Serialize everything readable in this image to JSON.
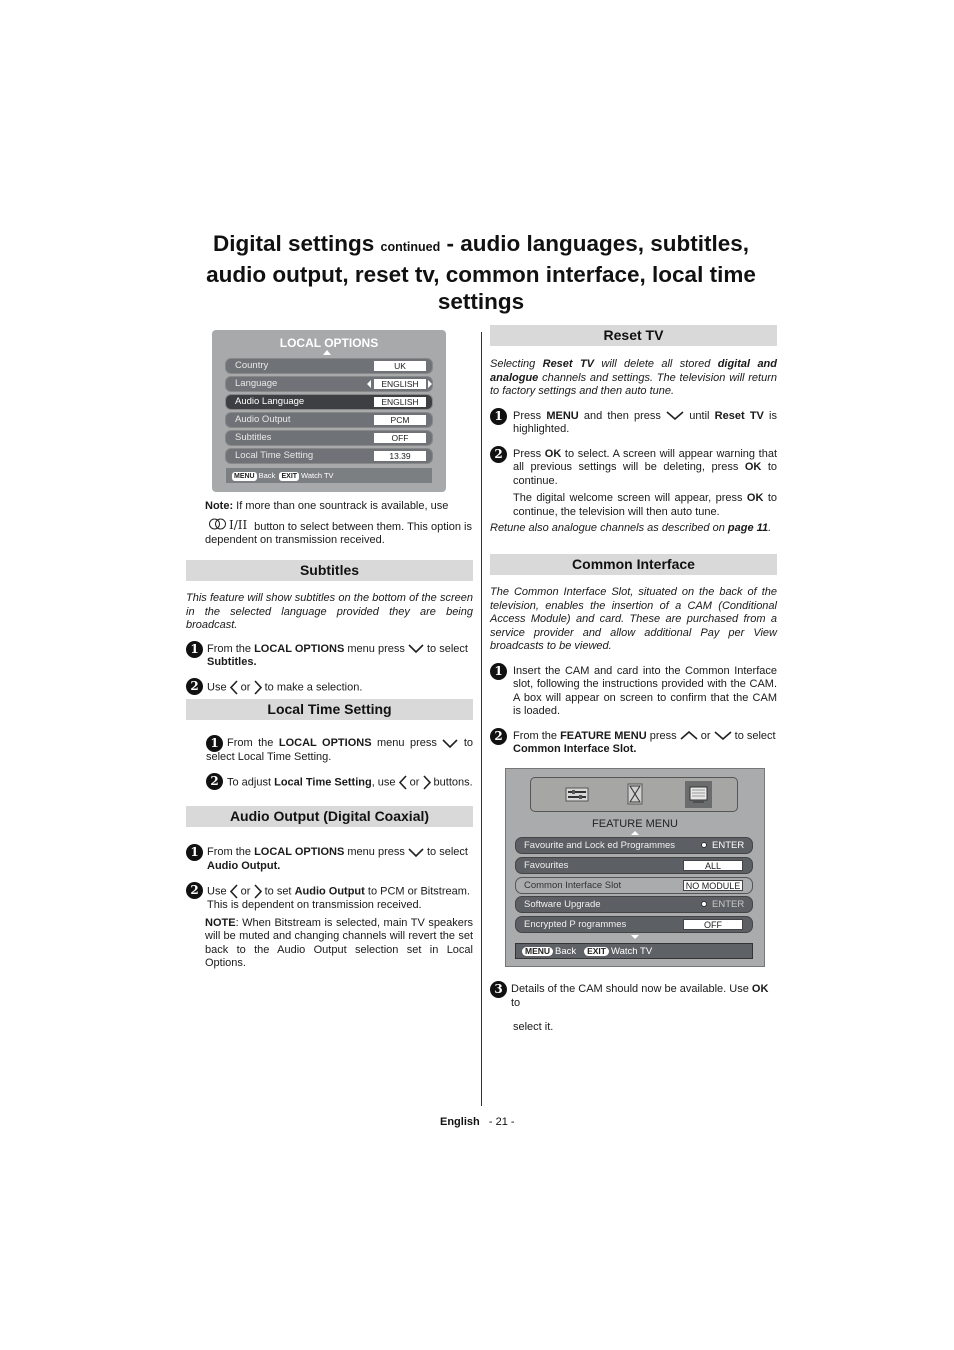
{
  "title": {
    "main": "Digital settings",
    "continued": "continued",
    "rest_line1": "- audio languages, subtitles,",
    "line2": "audio output, reset tv, common interface, local time",
    "line3": "settings"
  },
  "local_options_menu": {
    "title": "LOCAL OPTIONS",
    "rows": [
      {
        "label": "Country",
        "value": "UK"
      },
      {
        "label": "Language",
        "value": "ENGLISH"
      },
      {
        "label": "Audio Language",
        "value": "ENGLISH"
      },
      {
        "label": "Audio Output",
        "value": "PCM"
      },
      {
        "label": "Subtitles",
        "value": "OFF"
      },
      {
        "label": "Local Time Setting",
        "value": "13.39"
      }
    ],
    "footer": {
      "menu_key": "MENU",
      "menu_label": "Back",
      "exit_key": "EXIT",
      "exit_label": "Watch TV"
    }
  },
  "note": {
    "label": "Note:",
    "text1": " If more than one sountrack is available, use",
    "button_symbol": "ⵔⵔI/II",
    "text2": " button to select between them. This option is dependent on transmission received."
  },
  "subtitles": {
    "header": "Subtitles",
    "intro": "This feature will show subtitles on the bottom of the screen in the selected language provided they are being broadcast.",
    "step1": {
      "num": "1",
      "pre": "From the ",
      "bold1": "LOCAL OPTIONS",
      "mid": " menu press ",
      "post": " to select ",
      "bold2": "Subtitles."
    },
    "step2": {
      "num": "2",
      "pre": "Use ",
      "or": " or ",
      "post": " to make a selection."
    }
  },
  "local_time": {
    "header": "Local Time Setting",
    "step1": {
      "num": "1",
      "pre": "From the ",
      "bold1": "LOCAL OPTIONS",
      "mid": " menu press ",
      "post": " to select Local Time Setting."
    },
    "step2": {
      "num": "2",
      "pre": "To adjust ",
      "bold1": "Local Time Setting",
      "mid": ",  use ",
      "or": " or ",
      "post": " buttons."
    }
  },
  "audio_output": {
    "header": "Audio Output (Digital Coaxial)",
    "step1": {
      "num": "1",
      "pre": "From the ",
      "bold1": "LOCAL OPTIONS",
      "mid": " menu press ",
      "post": " to select ",
      "bold2": "Audio Output."
    },
    "step2": {
      "num": "2",
      "pre": "Use ",
      "or": " or ",
      "mid": " to set ",
      "bold1": "Audio Output",
      "post": " to PCM or Bitstream. This is dependent on transmission received."
    },
    "note_label": "NOTE",
    "note_text": ": When Bitstream is selected, main TV speakers will be muted and changing channels will revert the set back to the Audio Output selection set in Local Options."
  },
  "reset_tv": {
    "header": "Reset TV",
    "intro": {
      "pre": "Selecting ",
      "b1": "Reset TV",
      "mid": " will delete all stored ",
      "b2": "digital and analogue",
      "post": " channels and settings. The television will return to factory settings and then auto tune."
    },
    "step1": {
      "num": "1",
      "pre": "Press ",
      "b1": "MENU",
      "mid": " and then press ",
      "post": " until ",
      "b2": "Reset TV",
      "end": " is highlighted."
    },
    "step2": {
      "num": "2",
      "pre": "Press ",
      "b1": "OK",
      "mid": " to select. A screen will appear warning that all previous settings will be deleting, press ",
      "b2": "OK",
      "post": " to continue."
    },
    "step2b": {
      "pre": "The digital welcome screen will appear, press ",
      "b1": "OK",
      "post": " to continue, the television will then auto tune."
    },
    "retune": {
      "pre": "Retune also analogue channels as described on ",
      "b1": "page 11",
      "post": "."
    }
  },
  "common_interface": {
    "header": "Common Interface",
    "intro": "The Common Interface Slot, situated on the back of the television, enables the insertion of a CAM (Conditional Access Module) and card. These are purchased from a service provider and allow additional Pay per View broadcasts to be viewed.",
    "step1": {
      "num": "1",
      "text": "Insert the CAM and card into the Common Interface slot, following the instructions provided with the CAM. A box will appear on screen to confirm that the CAM is loaded."
    },
    "step2": {
      "num": "2",
      "pre": "From the ",
      "b1": "FEATURE MENU",
      "mid": " press ",
      "or": " or ",
      "post": " to select ",
      "b2": "Common Interface Slot."
    },
    "step3": {
      "num": "3",
      "pre": "Details of the CAM should now be available. Use ",
      "b1": "OK",
      "post": " to",
      "line2": "select  it."
    }
  },
  "feature_menu": {
    "title": "FEATURE MENU",
    "icons": [
      "settings-sliders-icon",
      "timer-icon",
      "screen-icon"
    ],
    "rows": [
      {
        "label": "Favourite and Lock  ed Programmes",
        "value": "ENTER",
        "type": "enter"
      },
      {
        "label": "Favourites",
        "value": "ALL",
        "type": "box"
      },
      {
        "label": "Common Interface Slot",
        "value": "NO MODULE",
        "type": "box"
      },
      {
        "label": "Software Upgrade",
        "value": "ENTER",
        "type": "enter"
      },
      {
        "label": "Encrypted P rogrammes",
        "value": "OFF",
        "type": "box"
      }
    ],
    "footer": {
      "menu_key": "MENU",
      "menu_label": "Back",
      "exit_key": "EXIT",
      "exit_label": "Watch TV"
    }
  },
  "footer": {
    "language": "English",
    "page": "- 21 -"
  }
}
